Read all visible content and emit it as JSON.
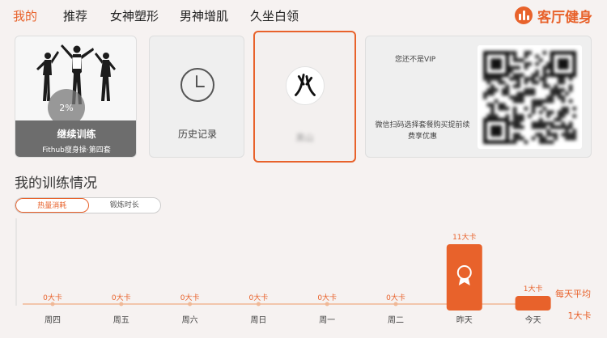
{
  "nav": {
    "tabs": [
      {
        "label": "我的",
        "active": true
      },
      {
        "label": "推荐",
        "active": false
      },
      {
        "label": "女神塑形",
        "active": false
      },
      {
        "label": "男神增肌",
        "active": false
      },
      {
        "label": "久坐白领",
        "active": false
      }
    ],
    "brand": "客厅健身"
  },
  "continue_card": {
    "progress": "2%",
    "title": "继续训练",
    "subtitle": "Fithub瘦身操·第四套"
  },
  "history_card": {
    "label": "历史记录",
    "icon": "clock-icon"
  },
  "user_card": {
    "name": "黑山",
    "icon": "user-logo-icon"
  },
  "vip_card": {
    "status": "您还不是VIP",
    "desc": "微信扫码选择套餐购买提前续费享优惠",
    "qr": "qr-code"
  },
  "training": {
    "title": "我的训练情况",
    "tabs": [
      {
        "label": "热量消耗",
        "active": true
      },
      {
        "label": "锻炼时长",
        "active": false
      }
    ]
  },
  "colors": {
    "accent": "#e8622b",
    "bg": "#f6f2f1"
  },
  "chart_data": {
    "type": "bar",
    "categories": [
      "周四",
      "周五",
      "周六",
      "周日",
      "周一",
      "周二",
      "昨天",
      "今天"
    ],
    "values": [
      0,
      0,
      0,
      0,
      0,
      0,
      11,
      1
    ],
    "value_labels": [
      "0大卡",
      "0大卡",
      "0大卡",
      "0大卡",
      "0大卡",
      "0大卡",
      "11大卡",
      "1大卡"
    ],
    "average_label": "每天平均",
    "average_value_label": "1大卡",
    "unit": "大卡",
    "ylim": [
      0,
      11
    ]
  }
}
